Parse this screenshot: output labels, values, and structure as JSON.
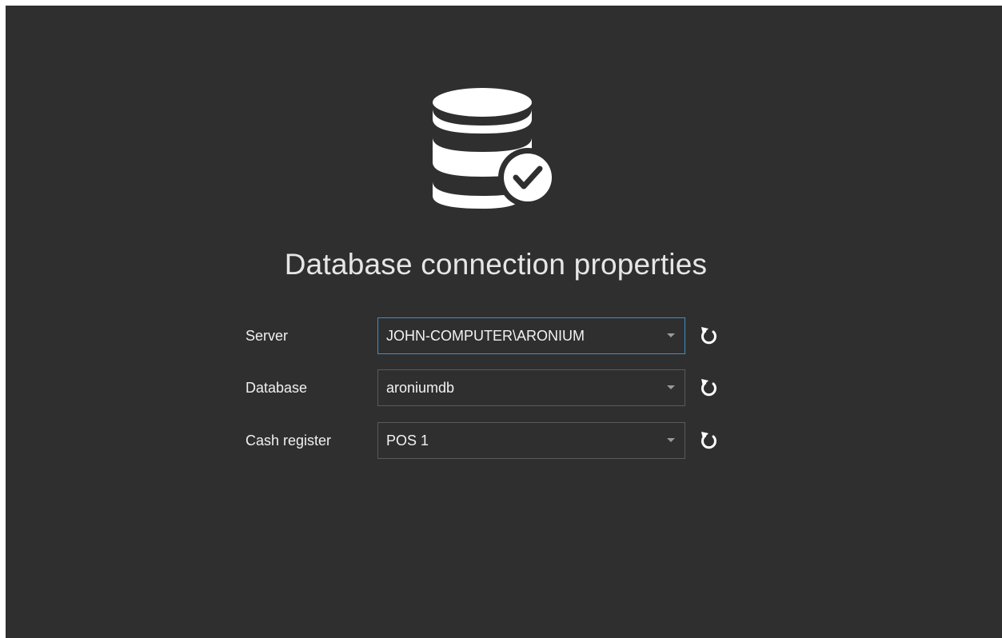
{
  "dialog": {
    "title": "Database connection properties",
    "icon": "database-check-icon"
  },
  "fields": [
    {
      "label": "Server",
      "value": "JOHN-COMPUTER\\ARONIUM",
      "focused": true
    },
    {
      "label": "Database",
      "value": "aroniumdb",
      "focused": false
    },
    {
      "label": "Cash register",
      "value": "POS 1",
      "focused": false
    }
  ],
  "colors": {
    "background": "#2f2f2f",
    "text": "#f0f0f0",
    "focus_border": "#3b8fd0",
    "border": "#5a5a5a"
  }
}
